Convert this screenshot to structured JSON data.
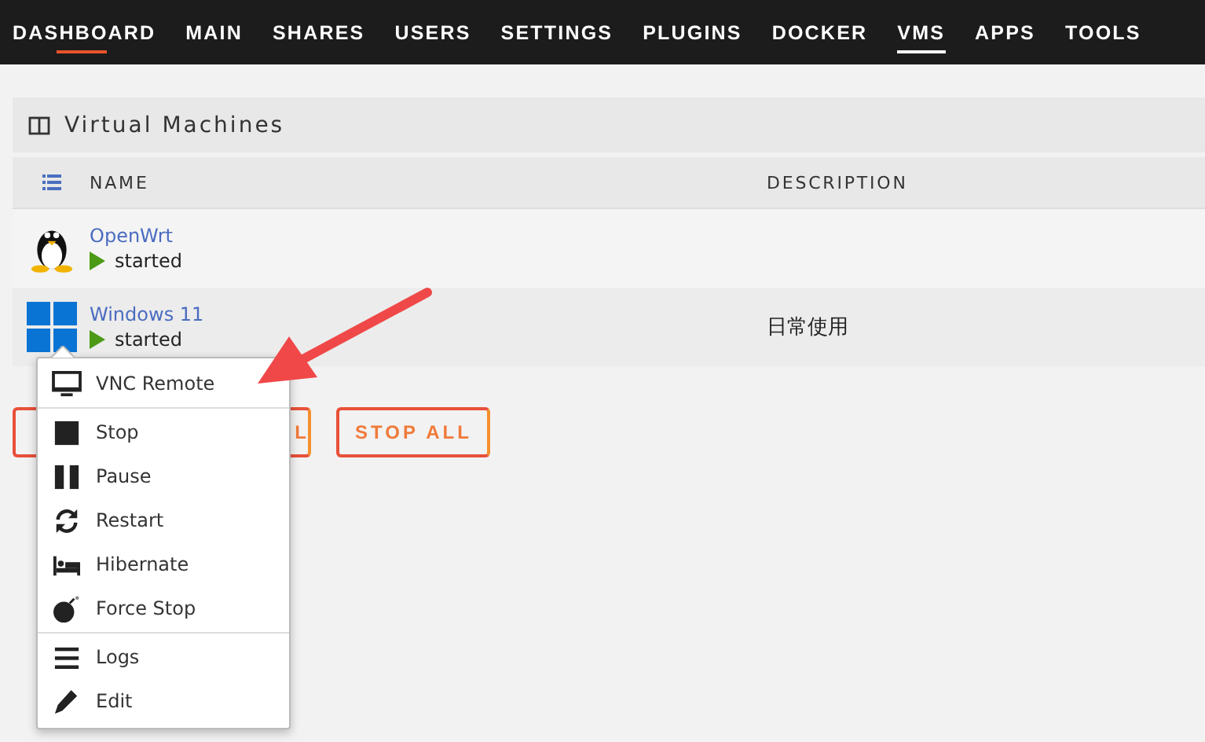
{
  "nav": [
    {
      "label": "DASHBOARD",
      "selected": false,
      "hovered": true
    },
    {
      "label": "MAIN",
      "selected": false,
      "hovered": false
    },
    {
      "label": "SHARES",
      "selected": false,
      "hovered": false
    },
    {
      "label": "USERS",
      "selected": false,
      "hovered": false
    },
    {
      "label": "SETTINGS",
      "selected": false,
      "hovered": false
    },
    {
      "label": "PLUGINS",
      "selected": false,
      "hovered": false
    },
    {
      "label": "DOCKER",
      "selected": false,
      "hovered": false
    },
    {
      "label": "VMS",
      "selected": true,
      "hovered": false
    },
    {
      "label": "APPS",
      "selected": false,
      "hovered": false
    },
    {
      "label": "TOOLS",
      "selected": false,
      "hovered": false
    }
  ],
  "panel": {
    "title": "Virtual Machines"
  },
  "table": {
    "columns": [
      "NAME",
      "DESCRIPTION"
    ],
    "rows": [
      {
        "kind": "linux",
        "name": "OpenWrt",
        "status": "started",
        "description": ""
      },
      {
        "kind": "windows",
        "name": "Windows 11",
        "status": "started",
        "description": "日常使用"
      }
    ]
  },
  "buttons": [
    {
      "label": "L"
    },
    {
      "label": "STOP ALL"
    }
  ],
  "context_menu": {
    "groups": [
      [
        {
          "kind": "monitor",
          "label": "VNC Remote"
        }
      ],
      [
        {
          "kind": "stop",
          "label": "Stop"
        },
        {
          "kind": "pause",
          "label": "Pause"
        },
        {
          "kind": "restart",
          "label": "Restart"
        },
        {
          "kind": "bed",
          "label": "Hibernate"
        },
        {
          "kind": "bomb",
          "label": "Force Stop"
        }
      ],
      [
        {
          "kind": "lines",
          "label": "Logs"
        },
        {
          "kind": "pencil",
          "label": "Edit"
        }
      ]
    ]
  },
  "annotation": {
    "kind": "arrow"
  }
}
